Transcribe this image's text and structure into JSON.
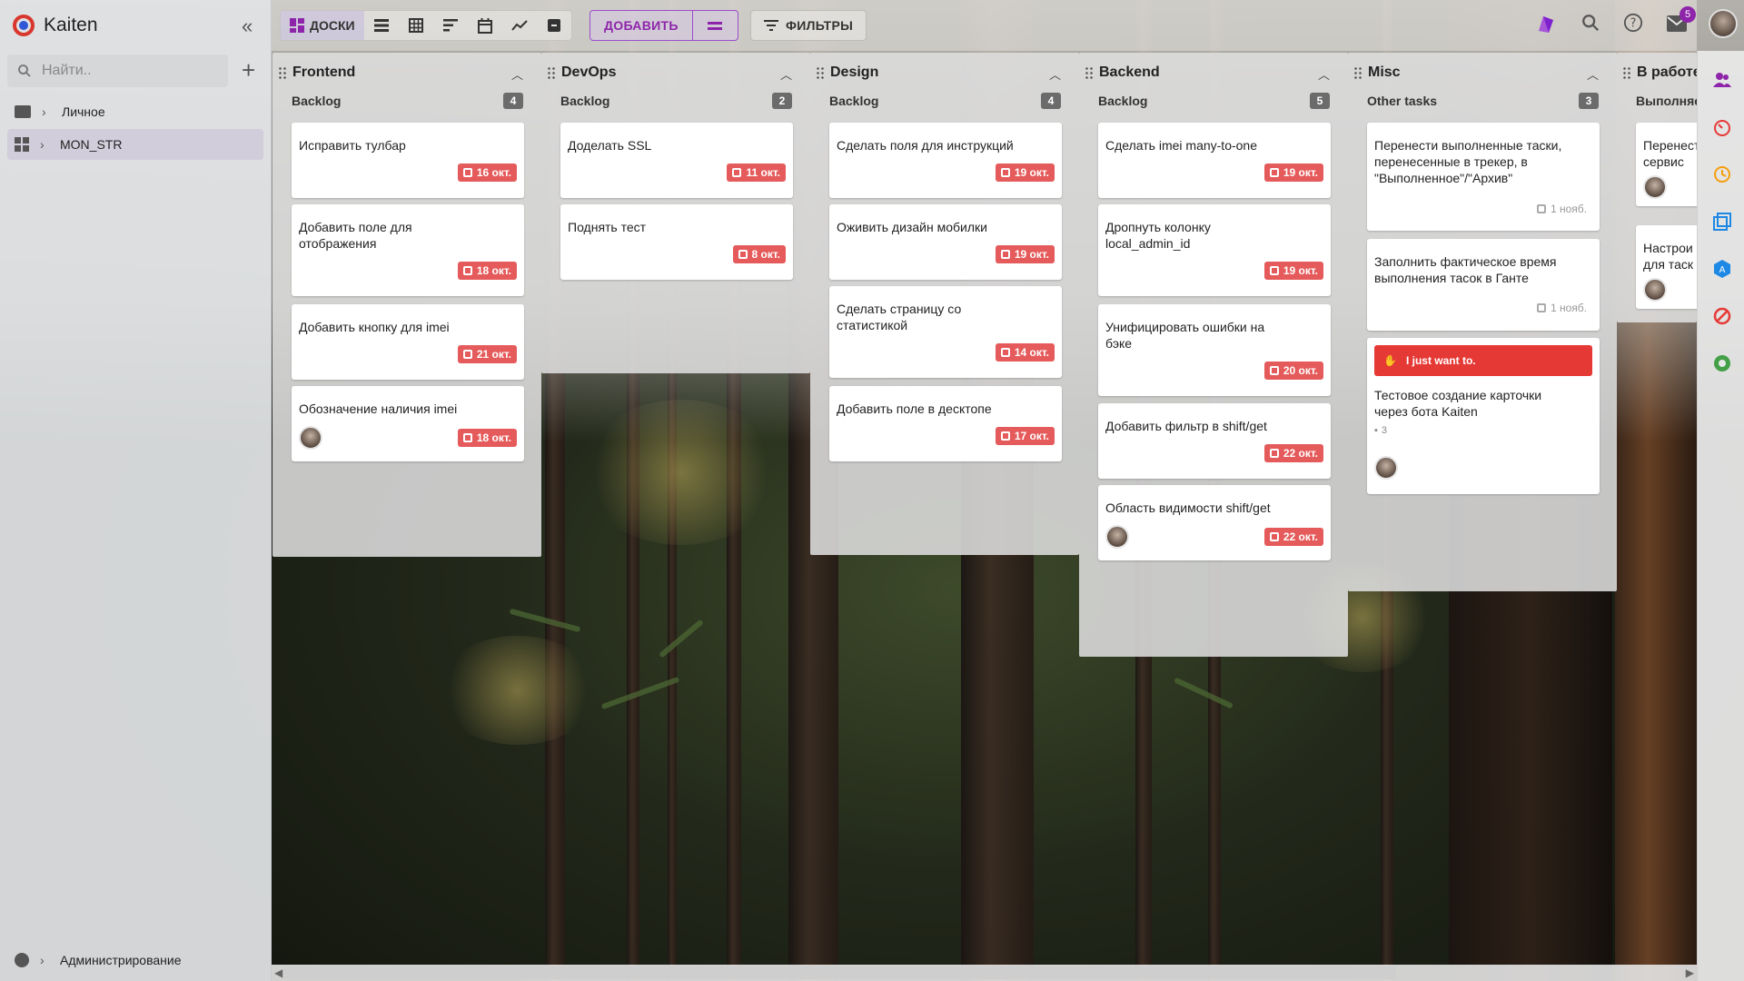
{
  "app": {
    "title": "Kaiten"
  },
  "sidebar": {
    "search_placeholder": "Найти..",
    "items": [
      {
        "label": "Личное",
        "icon": "folder-icon"
      },
      {
        "label": "MON_STR",
        "icon": "space-icon"
      }
    ],
    "footer": {
      "label": "Администрирование",
      "icon": "admin-icon"
    }
  },
  "toolbar": {
    "views": [
      {
        "name": "boards",
        "label": "ДОСКИ",
        "icon": "boards-icon",
        "active": true
      },
      {
        "name": "list",
        "label": "",
        "icon": "list-icon"
      },
      {
        "name": "table",
        "label": "",
        "icon": "table-icon"
      },
      {
        "name": "gantt",
        "label": "",
        "icon": "timeline-icon"
      },
      {
        "name": "calendar",
        "label": "",
        "icon": "calendar-icon"
      },
      {
        "name": "chart",
        "label": "",
        "icon": "chart-icon"
      },
      {
        "name": "archive",
        "label": "",
        "icon": "archive-icon"
      }
    ],
    "add_label": "ДОБАВИТЬ",
    "filters_label": "ФИЛЬТРЫ",
    "notifications_count": "5"
  },
  "colors": {
    "accent": "#8e24aa",
    "due": "#e55a5a",
    "banner": "#e53935"
  },
  "columns": [
    {
      "title": "Frontend",
      "lane": "Backlog",
      "count": "4",
      "cards": [
        {
          "title": "Исправить тулбар",
          "due": "16 окт."
        },
        {
          "title": "Добавить поле для отображения",
          "due": "18 окт."
        },
        {
          "title": "Добавить кнопку для imei",
          "due": "21 окт."
        },
        {
          "title": "Обозначение наличия imei",
          "due": "18 окт.",
          "avatar": true
        }
      ]
    },
    {
      "title": "DevOps",
      "lane": "Backlog",
      "count": "2",
      "cards": [
        {
          "title": "Доделать SSL",
          "due": "11 окт."
        },
        {
          "title": "Поднять тест",
          "due": "8 окт."
        }
      ]
    },
    {
      "title": "Design",
      "lane": "Backlog",
      "count": "4",
      "cards": [
        {
          "title": "Сделать поля для инструкций",
          "due": "19 окт."
        },
        {
          "title": "Оживить дизайн мобилки",
          "due": "19 окт."
        },
        {
          "title": "Сделать страницу со статистикой",
          "due": "14 окт."
        },
        {
          "title": "Добавить поле в десктопе",
          "due": "17 окт."
        }
      ]
    },
    {
      "title": "Backend",
      "lane": "Backlog",
      "count": "5",
      "cards": [
        {
          "title": "Сделать imei many-to-one",
          "due": "19 окт."
        },
        {
          "title": "Дропнуть колонку local_admin_id",
          "due": "19 окт."
        },
        {
          "title": "Унифицировать ошибки на бэке",
          "due": "20 окт."
        },
        {
          "title": "Добавить фильтр в shift/get",
          "due": "22 окт."
        },
        {
          "title": "Область видимости shift/get",
          "due": "22 окт.",
          "avatar": true
        }
      ]
    },
    {
      "title": "Misc",
      "lane": "Other tasks",
      "count": "3",
      "cards": [
        {
          "title": "Перенести выполненные таски, перенесенные в трекер, в \"Выполненное\"/\"Архив\"",
          "due": "1 нояб."
        },
        {
          "title": "Заполнить фактическое время выполнения тасок в Ганте",
          "due": "1 нояб."
        },
        {
          "title": "Тестовое создание карточки через бота Kaiten",
          "banner": "I just want to.",
          "comments": "3",
          "avatar": true
        }
      ]
    },
    {
      "title": "В работе",
      "lane": "Выполняе",
      "count": "",
      "cards": [
        {
          "title": "Перенест сервис",
          "avatar": true
        },
        {
          "title": "Настрои для таск",
          "avatar": true
        }
      ]
    }
  ]
}
